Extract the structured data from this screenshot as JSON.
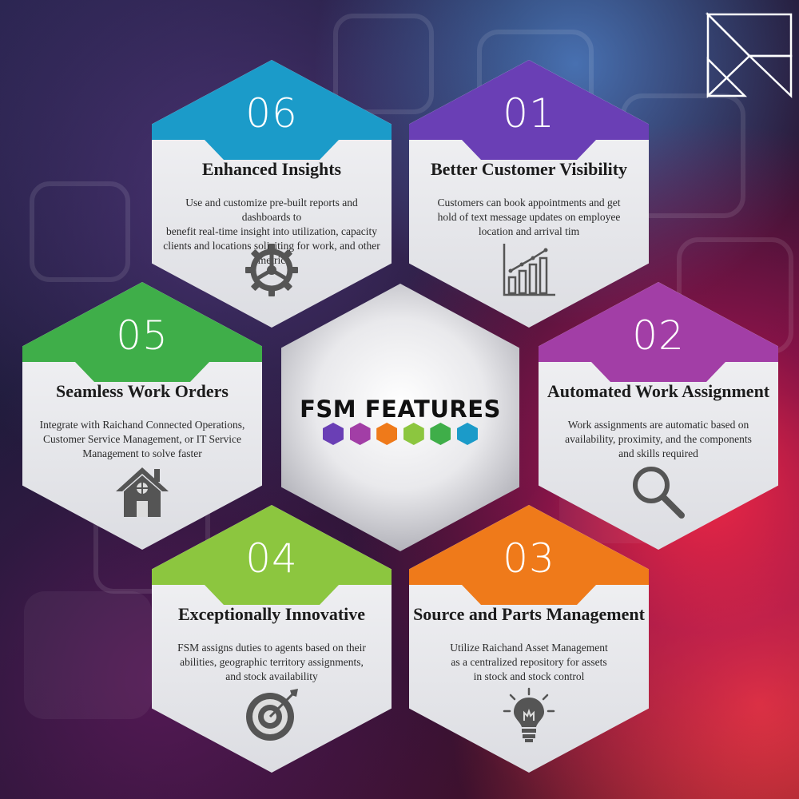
{
  "center": {
    "title": "FSM FEATURES",
    "dot_colors": [
      "#6a3fb5",
      "#a23ea6",
      "#ef7a1a",
      "#8cc63f",
      "#3fae49",
      "#1b9bc9"
    ]
  },
  "features": [
    {
      "number": "06",
      "title": "Enhanced Insights",
      "color": "#1b9bc9",
      "icon": "gear-icon",
      "desc": [
        "Use and customize pre-built reports and dashboards to",
        "benefit real-time insight into utilization, capacity",
        "clients and locations soliciting for work, and other metric"
      ]
    },
    {
      "number": "01",
      "title": "Better Customer Visibility",
      "color": "#6a3fb5",
      "icon": "bar-chart-icon",
      "desc": [
        "Customers can book appointments and get",
        "hold of text message updates on employee",
        "location and arrival tim"
      ]
    },
    {
      "number": "05",
      "title": "Seamless Work Orders",
      "color": "#3fae49",
      "icon": "house-icon",
      "desc": [
        "Integrate with Raichand Connected Operations,",
        "Customer Service Management, or IT Service",
        "Management to solve faster"
      ]
    },
    {
      "number": "02",
      "title": "Automated Work Assignment",
      "color": "#a23ea6",
      "icon": "magnifier-icon",
      "desc": [
        "Work assignments are automatic based on",
        "availability, proximity, and the components",
        "and skills required"
      ]
    },
    {
      "number": "04",
      "title": "Exceptionally Innovative",
      "color": "#8cc63f",
      "icon": "target-icon",
      "desc": [
        "FSM assigns duties to agents based on their",
        "abilities, geographic territory assignments,",
        "and stock availability"
      ]
    },
    {
      "number": "03",
      "title": "Source and Parts Management",
      "color": "#ef7a1a",
      "icon": "lightbulb-icon",
      "desc": [
        "Utilize Raichand Asset Management",
        "as a centralized repository for assets",
        "in stock and stock control"
      ]
    }
  ]
}
